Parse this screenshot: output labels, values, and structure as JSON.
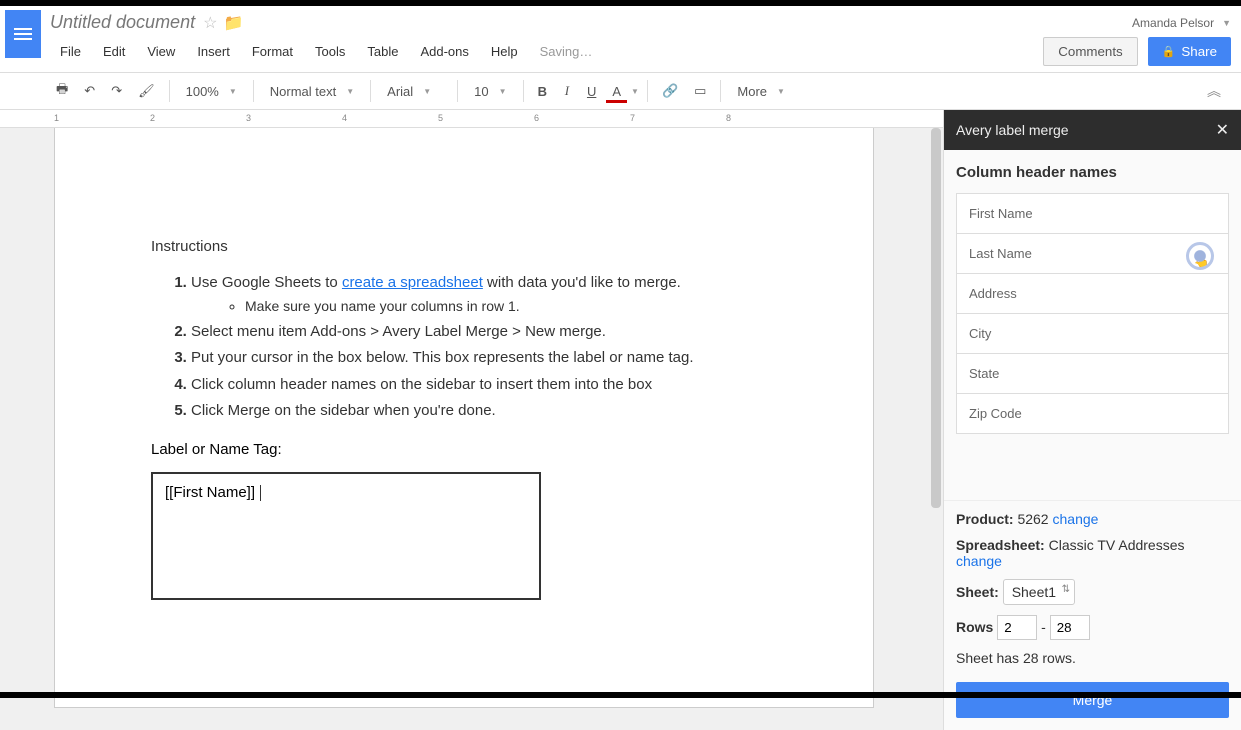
{
  "header": {
    "doc_title": "Untitled document",
    "user_name": "Amanda Pelsor",
    "comments_label": "Comments",
    "share_label": "Share"
  },
  "menu": {
    "items": [
      "File",
      "Edit",
      "View",
      "Insert",
      "Format",
      "Tools",
      "Table",
      "Add-ons",
      "Help"
    ],
    "saving": "Saving…"
  },
  "toolbar": {
    "zoom": "100%",
    "style": "Normal text",
    "font": "Arial",
    "size": "10",
    "more_label": "More"
  },
  "ruler": {
    "ticks": [
      "1",
      "2",
      "3",
      "4",
      "5",
      "6",
      "7",
      "8"
    ]
  },
  "doc": {
    "instructions_heading": "Instructions",
    "step1_pre": "Use Google Sheets to ",
    "step1_link": "create a spreadsheet",
    "step1_post": " with data you'd like to merge.",
    "step1_sub": "Make sure you name your columns in row 1.",
    "step2": "Select menu item Add-ons > Avery Label Merge > New merge.",
    "step3": "Put your cursor in the box below. This box represents the label or name tag.",
    "step4": "Click column header names on the sidebar to insert them into the box",
    "step5": "Click Merge on the sidebar when you're done.",
    "label_heading": "Label or Name Tag:",
    "label_box_content": "[[First Name]]"
  },
  "sidebar": {
    "title": "Avery label merge",
    "column_header_title": "Column header names",
    "columns": [
      "First Name",
      "Last Name",
      "Address",
      "City",
      "State",
      "Zip Code"
    ],
    "product_label": "Product:",
    "product_value": "5262",
    "spreadsheet_label": "Spreadsheet:",
    "spreadsheet_value": "Classic TV Addresses",
    "sheet_label": "Sheet:",
    "sheet_value": "Sheet1",
    "rows_label": "Rows",
    "rows_from": "2",
    "rows_to": "28",
    "rows_dash": "-",
    "rows_info": "Sheet has 28 rows.",
    "change_label": "change",
    "merge_button": "Merge"
  }
}
